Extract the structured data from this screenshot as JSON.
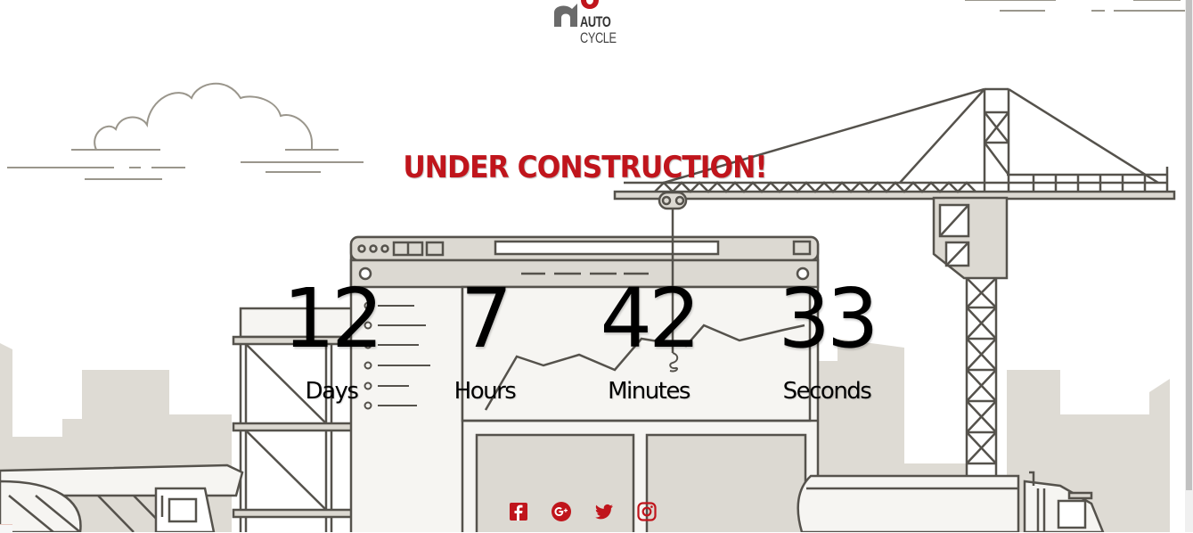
{
  "brand": {
    "line1": "AUTO",
    "line2": "CYCLE",
    "accent_color": "#c0151c"
  },
  "headline": "UNDER CONSTRUCTION!",
  "countdown": [
    {
      "value": "12",
      "label": "Days"
    },
    {
      "value": "7",
      "label": "Hours"
    },
    {
      "value": "42",
      "label": "Minutes"
    },
    {
      "value": "33",
      "label": "Seconds"
    }
  ],
  "social": [
    {
      "icon": "facebook-icon"
    },
    {
      "icon": "google-plus-icon"
    },
    {
      "icon": "twitter-icon"
    },
    {
      "icon": "instagram-icon"
    }
  ],
  "colors": {
    "line": "#55524c",
    "fill_light": "#dcd9d2",
    "fill_pale": "#f6f5f2",
    "ground": "#dedbd4"
  }
}
